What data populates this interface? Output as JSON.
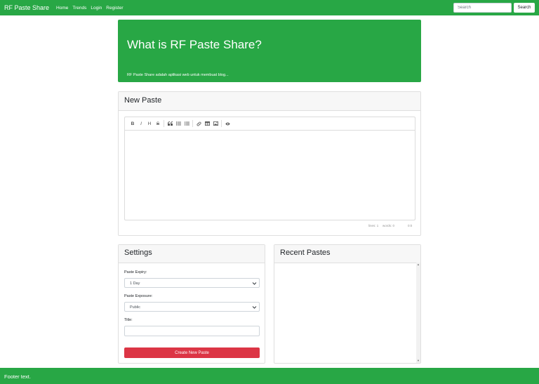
{
  "navbar": {
    "brand": "RF Paste Share",
    "links": [
      "Home",
      "Trends",
      "Login",
      "Register"
    ],
    "search_placeholder": "Search",
    "search_button": "Search"
  },
  "jumbotron": {
    "title": "What is RF Paste Share?",
    "subtitle": "RF Paste Share adalah aplikasi web untuk membuat blog..."
  },
  "new_paste": {
    "header": "New Paste",
    "toolbar_icons": [
      "bold-icon",
      "italic-icon",
      "heading-icon",
      "strikethrough-icon",
      "quote-icon",
      "unordered-list-icon",
      "ordered-list-icon",
      "link-icon",
      "table-icon",
      "image-icon",
      "preview-eye-icon"
    ],
    "toolbar_glyphs": {
      "bold": "B",
      "italic": "I",
      "heading": "H",
      "strike": "S"
    },
    "status": {
      "lines": "lines: 1",
      "words": "words: 0",
      "cursor": "0:0"
    }
  },
  "settings": {
    "header": "Settings",
    "expiry_label": "Paste Expiry:",
    "expiry_value": "1 Day",
    "exposure_label": "Paste Exposure:",
    "exposure_value": "Public",
    "title_label": "Title:",
    "title_value": "",
    "create_button": "Create New Paste"
  },
  "recent": {
    "header": "Recent Pastes"
  },
  "footer": {
    "text": "Footer text."
  },
  "colors": {
    "brand_green": "#28a745",
    "danger_red": "#dc3545"
  }
}
